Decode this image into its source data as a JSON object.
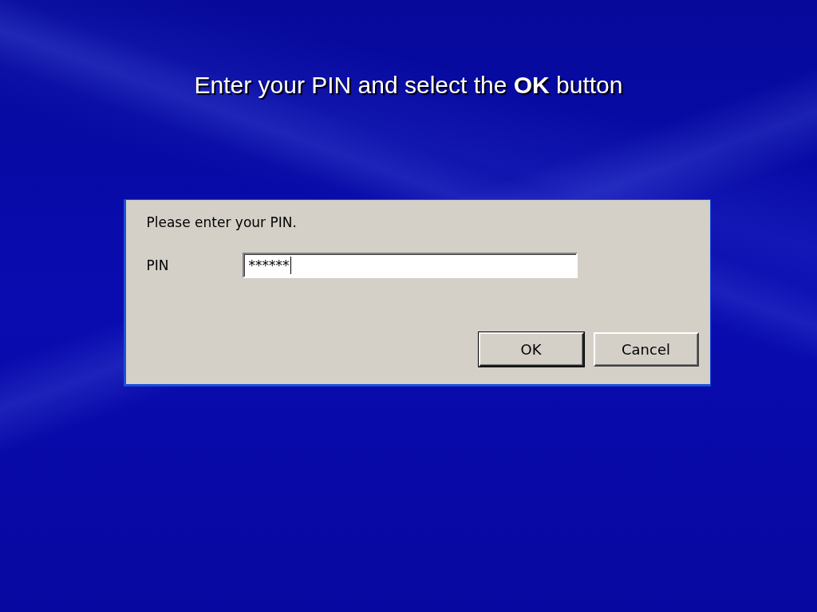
{
  "slide_title": "Enter your PIN and select the **OK** button",
  "dialog": {
    "message": "Please enter your PIN.",
    "field": {
      "label": "PIN",
      "value": "******",
      "focused": true
    },
    "buttons": [
      {
        "label": "OK",
        "default": true
      },
      {
        "label": "Cancel",
        "default": false
      }
    ]
  }
}
